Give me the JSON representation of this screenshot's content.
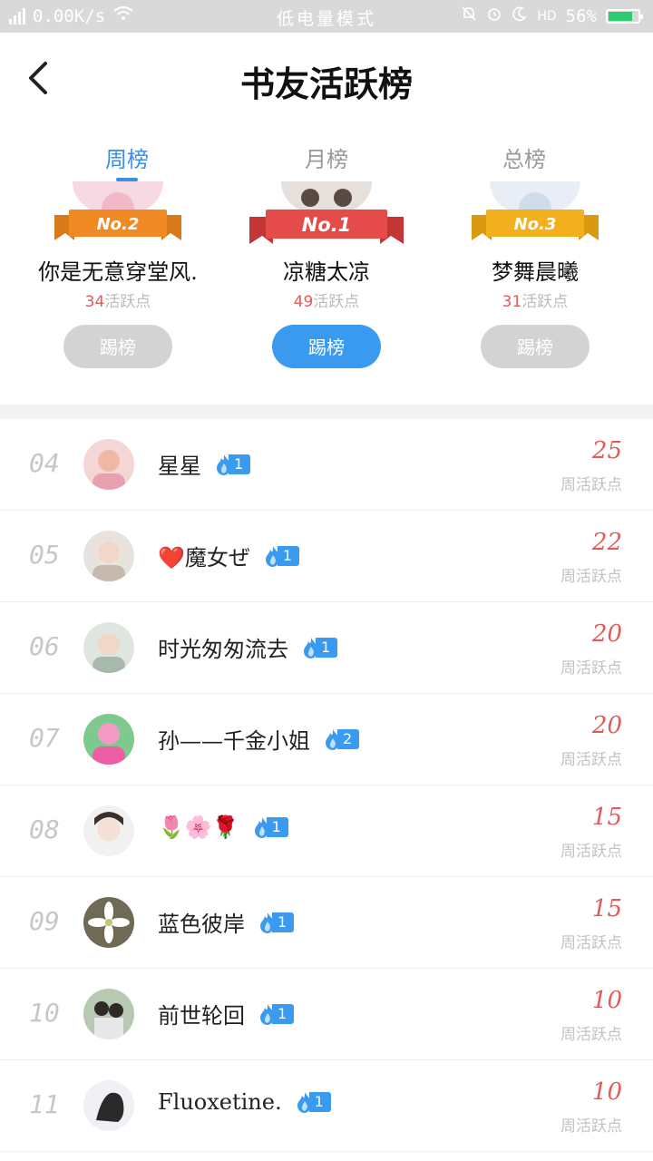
{
  "status_bar": {
    "network_type": "4G",
    "speed": "0.00K/s",
    "mode_text": "低电量模式",
    "hd": "HD",
    "battery_pct": "56%"
  },
  "header": {
    "title": "书友活跃榜"
  },
  "tabs": [
    {
      "label": "周榜",
      "active": true
    },
    {
      "label": "月榜",
      "active": false
    },
    {
      "label": "总榜",
      "active": false
    }
  ],
  "podium": {
    "second": {
      "badge": "No.2",
      "name": "你是无意穿堂风.",
      "points": "34",
      "points_unit": "活跃点",
      "button": "踢榜"
    },
    "first": {
      "badge": "No.1",
      "name": "凉糖太凉",
      "points": "49",
      "points_unit": "活跃点",
      "button": "踢榜"
    },
    "third": {
      "badge": "No.3",
      "name": "梦舞晨曦",
      "points": "31",
      "points_unit": "活跃点",
      "button": "踢榜"
    }
  },
  "list": [
    {
      "rank": "04",
      "name": "星星",
      "level": "1",
      "score": "25",
      "score_label": "周活跃点"
    },
    {
      "rank": "05",
      "name": "❤️魔女ぜ",
      "level": "1",
      "score": "22",
      "score_label": "周活跃点"
    },
    {
      "rank": "06",
      "name": "时光匆匆流去",
      "level": "1",
      "score": "20",
      "score_label": "周活跃点"
    },
    {
      "rank": "07",
      "name": "孙——千金小姐",
      "level": "2",
      "score": "20",
      "score_label": "周活跃点"
    },
    {
      "rank": "08",
      "name": "🌷🌸🌹",
      "level": "1",
      "score": "15",
      "score_label": "周活跃点"
    },
    {
      "rank": "09",
      "name": "蓝色彼岸",
      "level": "1",
      "score": "15",
      "score_label": "周活跃点"
    },
    {
      "rank": "10",
      "name": "前世轮回",
      "level": "1",
      "score": "10",
      "score_label": "周活跃点"
    },
    {
      "rank": "11",
      "name": "Fluoxetine.",
      "level": "1",
      "score": "10",
      "score_label": "周活跃点"
    }
  ],
  "colors": {
    "accent": "#3a9af0",
    "score_red": "#e35a5a",
    "ribbon_gold": "#f2b01e",
    "ribbon_red": "#e64b4b",
    "ribbon_orange": "#f08a24"
  }
}
